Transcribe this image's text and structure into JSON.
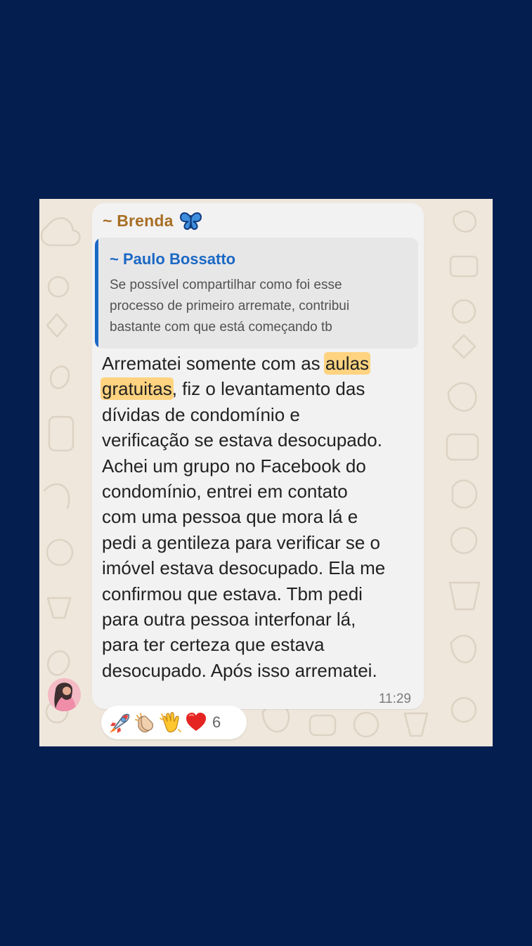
{
  "chat": {
    "sender": "~ Brenda",
    "sender_icon": "butterfly-icon",
    "sender_color": "#a86f25",
    "quote": {
      "author": "~ Paulo Bossatto",
      "author_color": "#1b68c4",
      "lines": [
        "Se possível compartilhar como foi esse",
        "processo de primeiro arremate,  contribui",
        "bastante com que está começando tb"
      ]
    },
    "message": {
      "before_highlight": "Arrematei somente com as ",
      "highlight_1": "aulas",
      "highlight_2": "gratuitas",
      "first_line_after_highlight": ", fiz o levantamento das",
      "lines": [
        "dívidas de condomínio e",
        "verificação se estava desocupado.",
        "Achei um grupo no Facebook do",
        "condomínio, entrei em contato",
        "com uma pessoa que mora lá e",
        "pedi a gentileza para verificar se o",
        "imóvel estava desocupado. Ela me",
        "confirmou que estava. Tbm pedi",
        "para outra pessoa interfonar lá,",
        "para ter certeza que estava",
        "desocupado. Após isso arrematei."
      ],
      "highlight_color": "#ffd37f"
    },
    "time": "11:29",
    "avatar_icon": "profile-avatar-icon",
    "reactions": {
      "icons": [
        "rocket-icon",
        "clapping-hands-icon",
        "waving-hand-icon",
        "red-heart-icon"
      ],
      "count": "6"
    }
  },
  "colors": {
    "page_background": "#041f4f",
    "chat_background": "#efe7dc",
    "bubble_background": "#f2f2f3"
  }
}
